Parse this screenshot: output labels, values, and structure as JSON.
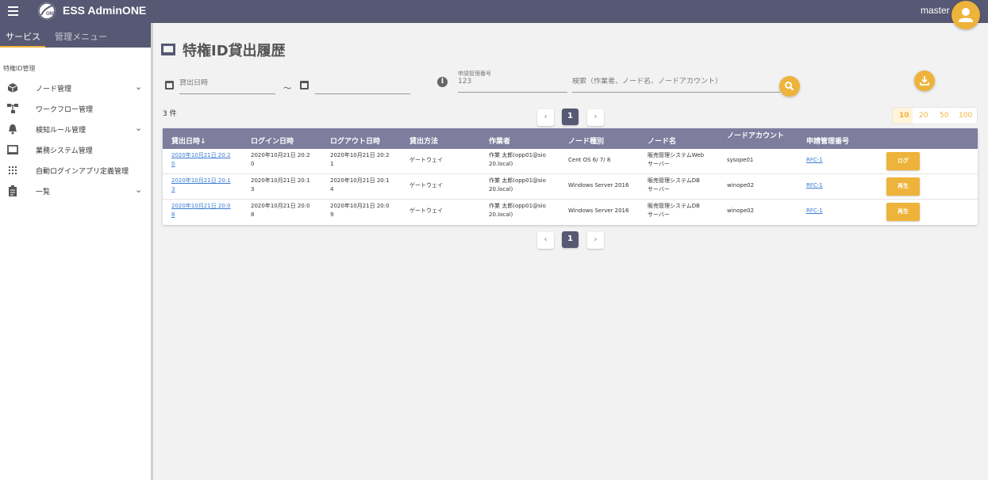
{
  "app": {
    "title": "ESS AdminONE",
    "user": "master"
  },
  "sidebar": {
    "tabs": [
      "サービス",
      "管理メニュー"
    ],
    "section": "特権ID管理",
    "items": [
      {
        "label": "ノード管理",
        "icon": "cube-icon",
        "expandable": true
      },
      {
        "label": "ワークフロー管理",
        "icon": "workflow-icon",
        "expandable": false
      },
      {
        "label": "検知ルール管理",
        "icon": "bell-icon",
        "expandable": true
      },
      {
        "label": "業務システム管理",
        "icon": "system-icon",
        "expandable": false
      },
      {
        "label": "自動ログインアプリ定義管理",
        "icon": "apps-icon",
        "expandable": false
      },
      {
        "label": "一覧",
        "icon": "clipboard-icon",
        "expandable": true
      }
    ]
  },
  "page": {
    "title": "特権ID貸出履歴"
  },
  "search": {
    "date_from_placeholder": "貸出日時",
    "tilde": "～",
    "request_number_label": "申請管理番号",
    "request_number_placeholder": "123",
    "keyword_placeholder": "検索（作業者、ノード名、ノードアカウント）"
  },
  "results": {
    "count_text": "3 件"
  },
  "pagination": {
    "prev": "‹",
    "current": "1",
    "next": "›"
  },
  "per_page": {
    "options": [
      "10",
      "20",
      "50",
      "100"
    ],
    "selected": "10"
  },
  "table": {
    "headers": [
      "貸出日時↓",
      "ログイン日時",
      "ログアウト日時",
      "貸出方法",
      "作業者",
      "ノード種別",
      "ノード名",
      "ノードアカウント",
      "申請管理番号"
    ],
    "rows": [
      {
        "lend_l1": "2020年10月21日 20:2",
        "lend_l2": "0",
        "login_l1": "2020年10月21日 20:2",
        "login_l2": "0",
        "logout_l1": "2020年10月21日 20:2",
        "logout_l2": "1",
        "method": "ゲートウェイ",
        "worker_l1": "作業 太郎(opp01@sio",
        "worker_l2": "20.local)",
        "node_type": "Cent OS 6/ 7/ 8",
        "node_l1": "販売管理システムWeb",
        "node_l2": "サーバー",
        "account": "sysope01",
        "rfc": "RFC-1",
        "action": "ログ"
      },
      {
        "lend_l1": "2020年10月21日 20:1",
        "lend_l2": "3",
        "login_l1": "2020年10月21日 20:1",
        "login_l2": "3",
        "logout_l1": "2020年10月21日 20:1",
        "logout_l2": "4",
        "method": "ゲートウェイ",
        "worker_l1": "作業 太郎(opp01@sio",
        "worker_l2": "20.local)",
        "node_type": "Windows Server 2016",
        "node_l1": "販売管理システムDB",
        "node_l2": "サーバー",
        "account": "winope02",
        "rfc": "RFC-1",
        "action": "再生"
      },
      {
        "lend_l1": "2020年10月21日 20:0",
        "lend_l2": "8",
        "login_l1": "2020年10月21日 20:0",
        "login_l2": "8",
        "logout_l1": "2020年10月21日 20:0",
        "logout_l2": "9",
        "method": "ゲートウェイ",
        "worker_l1": "作業 太郎(opp01@sio",
        "worker_l2": "20.local)",
        "node_type": "Windows Server 2016",
        "node_l1": "販売管理システムDB",
        "node_l2": "サーバー",
        "account": "winope02",
        "rfc": "RFC-1",
        "action": "再生"
      }
    ]
  },
  "colors": {
    "header": "#575873",
    "table_header": "#7e7d9e",
    "accent": "#eeb33a",
    "link": "#3a7bd5"
  }
}
